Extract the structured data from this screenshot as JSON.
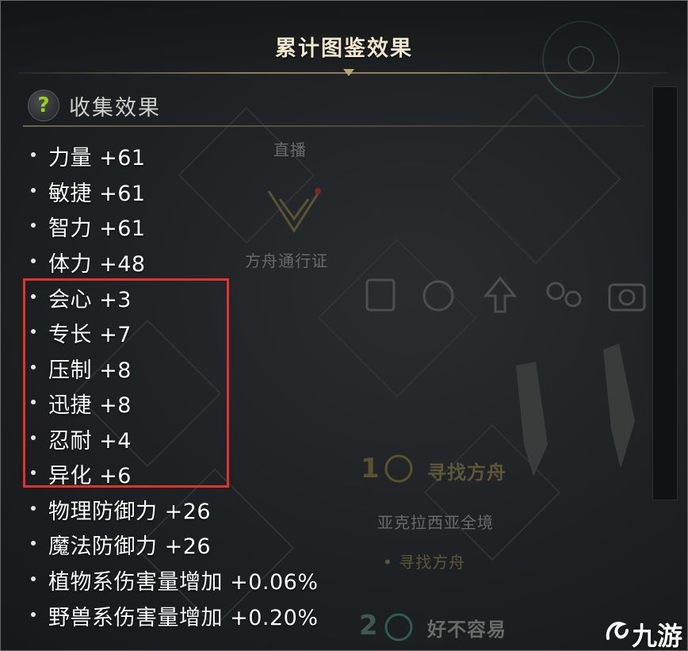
{
  "window": {
    "title": "累计图鉴效果"
  },
  "section": {
    "title": "收集效果",
    "help_glyph": "?"
  },
  "stats": [
    {
      "label": "力量 +61",
      "highlighted": false
    },
    {
      "label": "敏捷 +61",
      "highlighted": false
    },
    {
      "label": "智力 +61",
      "highlighted": false
    },
    {
      "label": "体力 +48",
      "highlighted": false
    },
    {
      "label": "会心 +3",
      "highlighted": true
    },
    {
      "label": "专长 +7",
      "highlighted": true
    },
    {
      "label": "压制 +8",
      "highlighted": true
    },
    {
      "label": "迅捷 +8",
      "highlighted": true
    },
    {
      "label": "忍耐 +4",
      "highlighted": true
    },
    {
      "label": "异化 +6",
      "highlighted": true
    },
    {
      "label": "物理防御力 +26",
      "highlighted": false
    },
    {
      "label": "魔法防御力 +26",
      "highlighted": false
    },
    {
      "label": "植物系伤害量增加 +0.06%",
      "highlighted": false
    },
    {
      "label": "野兽系伤害量增加 +0.20%",
      "highlighted": false
    }
  ],
  "background_ui": {
    "live_label": "直播",
    "pass_label": "方舟通行证",
    "quest_number_1": "1",
    "quest_title_1": "寻找方舟",
    "quest_region": "亚克拉西亚全境",
    "quest_sub": "• 寻找方舟",
    "quest_number_2": "2",
    "quest_title_2": "好不容易"
  },
  "watermark": {
    "text": "九游"
  },
  "colors": {
    "highlight_border": "#e4322a",
    "title_text": "#efe6cc",
    "help_glyph": "#9ad11c",
    "stat_text": "#ffffff"
  }
}
